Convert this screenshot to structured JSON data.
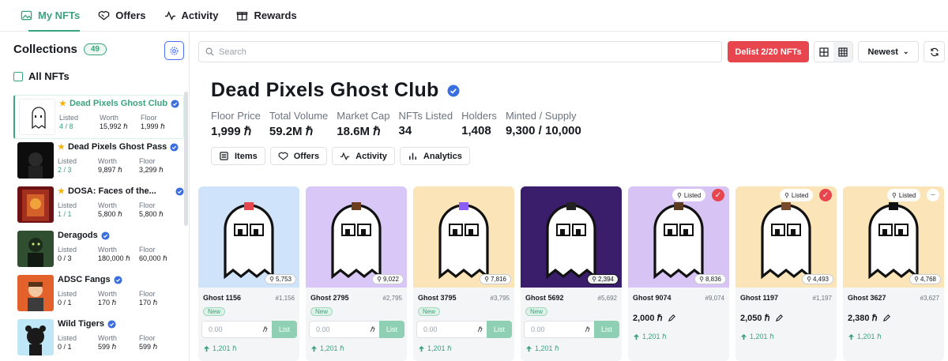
{
  "nav": {
    "items": [
      {
        "label": "My NFTs",
        "icon": "image-icon"
      },
      {
        "label": "Offers",
        "icon": "handshake-icon"
      },
      {
        "label": "Activity",
        "icon": "activity-icon"
      },
      {
        "label": "Rewards",
        "icon": "gift-icon"
      }
    ]
  },
  "sidebar": {
    "title": "Collections",
    "count": "49",
    "all_label": "All NFTs",
    "collections": [
      {
        "name": "Dead Pixels Ghost Club",
        "starred": true,
        "listed": "4 / 8",
        "worth": "15,992 ℏ",
        "floor": "1,999 ℏ"
      },
      {
        "name": "Dead Pixels Ghost Pass",
        "starred": true,
        "listed": "2 / 3",
        "worth": "9,897 ℏ",
        "floor": "3,299 ℏ"
      },
      {
        "name": "DOSA: Faces of the...",
        "starred": true,
        "listed": "1 / 1",
        "worth": "5,800 ℏ",
        "floor": "5,800 ℏ"
      },
      {
        "name": "Deragods",
        "starred": false,
        "listed": "0 / 3",
        "worth": "180,000 ℏ",
        "floor": "60,000 ℏ"
      },
      {
        "name": "ADSC Fangs",
        "starred": false,
        "listed": "0 / 1",
        "worth": "170 ℏ",
        "floor": "170 ℏ"
      },
      {
        "name": "Wild Tigers",
        "starred": false,
        "listed": "0 / 1",
        "worth": "599 ℏ",
        "floor": "599 ℏ"
      }
    ],
    "labels": {
      "listed": "Listed",
      "worth": "Worth",
      "floor": "Floor"
    }
  },
  "toolbar": {
    "search_placeholder": "Search",
    "delist_label": "Delist 2/20 NFTs",
    "sort_label": "Newest"
  },
  "collection": {
    "title": "Dead Pixels Ghost Club",
    "stats": [
      {
        "label": "Floor Price",
        "value": "1,999 ℏ"
      },
      {
        "label": "Total Volume",
        "value": "59.2M ℏ"
      },
      {
        "label": "Market Cap",
        "value": "18.6M ℏ"
      },
      {
        "label": "NFTs Listed",
        "value": "34"
      },
      {
        "label": "Holders",
        "value": "1,408"
      },
      {
        "label": "Minted / Supply",
        "value": "9,300 / 10,000"
      }
    ],
    "tabs": [
      {
        "label": "Items",
        "icon": "list-icon"
      },
      {
        "label": "Offers",
        "icon": "handshake-icon"
      },
      {
        "label": "Activity",
        "icon": "activity-icon"
      },
      {
        "label": "Analytics",
        "icon": "bar-chart-icon"
      }
    ]
  },
  "cards": [
    {
      "name": "Ghost 1156",
      "num": "#1,156",
      "rank": "5,753",
      "listed": false,
      "badge": "New",
      "price_placeholder": "0.00",
      "list_label": "List",
      "last": "1,201 ℏ",
      "bg": "#cfe4fb"
    },
    {
      "name": "Ghost 2795",
      "num": "#2,795",
      "rank": "9,022",
      "listed": false,
      "badge": "New",
      "price_placeholder": "0.00",
      "list_label": "List",
      "last": "1,201 ℏ",
      "bg": "#d9c8f7"
    },
    {
      "name": "Ghost 3795",
      "num": "#3,795",
      "rank": "7,816",
      "listed": false,
      "badge": "New",
      "price_placeholder": "0.00",
      "list_label": "List",
      "last": "1,201 ℏ",
      "bg": "#fbe5b8"
    },
    {
      "name": "Ghost 5692",
      "num": "#5,692",
      "rank": "2,394",
      "listed": false,
      "badge": "New",
      "price_placeholder": "0.00",
      "list_label": "List",
      "last": "1,201 ℏ",
      "bg": "#3a1d6b"
    },
    {
      "name": "Ghost 9074",
      "num": "#9,074",
      "rank": "8,836",
      "listed": true,
      "listed_label": "Listed",
      "price": "2,000 ℏ",
      "last": "1,201 ℏ",
      "bg": "#d7c4f5",
      "selected": true
    },
    {
      "name": "Ghost 1197",
      "num": "#1,197",
      "rank": "4,493",
      "listed": true,
      "listed_label": "Listed",
      "price": "2,050 ℏ",
      "last": "1,201 ℏ",
      "bg": "#fbe5b8",
      "selected": true
    },
    {
      "name": "Ghost 3627",
      "num": "#3,627",
      "rank": "4,768",
      "listed": true,
      "listed_label": "Listed",
      "price": "2,380 ℏ",
      "last": "1,201 ℏ",
      "bg": "#fbe5b8",
      "selected": false
    }
  ],
  "colors": {
    "accent": "#3aa37f",
    "danger": "#e8464e",
    "link": "#4a6cf7"
  }
}
